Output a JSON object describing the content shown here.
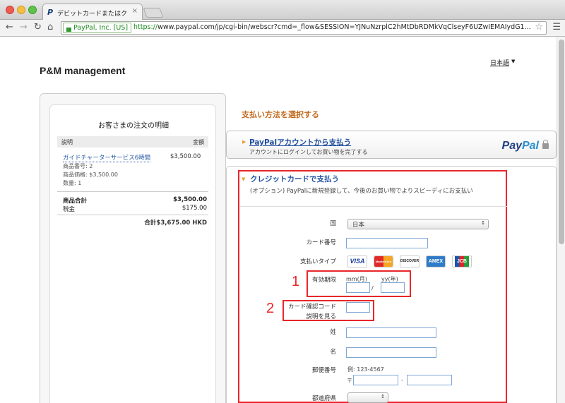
{
  "browser": {
    "tab_title": "デビットカードまたはクレジットカード",
    "tab_close": "×",
    "ev_badge": "PayPal, Inc. [US]",
    "url_scheme": "https://",
    "url_rest": "www.paypal.com/jp/cgi-bin/webscr?cmd=_flow&SESSION=YJNuNzrplC2hMtDbRDMkVqClseyF6UZwIEMAIydG1..."
  },
  "page": {
    "merchant": "P&M management",
    "language": "日本語"
  },
  "order": {
    "title": "お客さまの注文の明細",
    "col_desc": "説明",
    "col_amount": "金額",
    "item_name": "ガイドチャーターサービス6時間",
    "item_price": "$3,500.00",
    "item_number": "商品番号: 2",
    "item_unit_price": "商品価格: $3,500.00",
    "item_qty": "数量: 1",
    "subtotal_label": "商品合計",
    "subtotal_value": "$3,500.00",
    "tax_label": "税金",
    "tax_value": "$175.00",
    "total": "合計$3,675.00 HKD"
  },
  "payment": {
    "heading": "支払い方法を選択する",
    "paypal_link": "PayPalアカウントから支払う",
    "paypal_sub": "アカウントにログインしてお買い物を完了する",
    "paypal_logo_1": "Pay",
    "paypal_logo_2": "Pal",
    "cc_title": "クレジットカードで支払う",
    "cc_sub": "(オプション) PayPalに新規登録して、今後のお買い物でよりスピーディにお支払い"
  },
  "form": {
    "country_label": "国",
    "country_value": "日本",
    "card_number_label": "カード番号",
    "pay_type_label": "支払いタイプ",
    "card_types": [
      "VISA",
      "MasterCard",
      "DISCOVER",
      "AMEX",
      "JCB"
    ],
    "expiry_label": "有効期限",
    "expiry_month_hint": "mm(月)",
    "expiry_year_hint": "yy(年)",
    "expiry_sep": "/",
    "cvv_label": "カード確認コード",
    "cvv_help": "説明を見る",
    "last_name_label": "姓",
    "first_name_label": "名",
    "postal_label": "郵便番号",
    "postal_example": "例: 123-4567",
    "postal_prefix": "〒",
    "postal_sep": "-",
    "prefecture_label": "都道府県"
  },
  "annotations": {
    "marker_1": "1",
    "marker_2": "2",
    "highlight_color": "#e8262a"
  }
}
